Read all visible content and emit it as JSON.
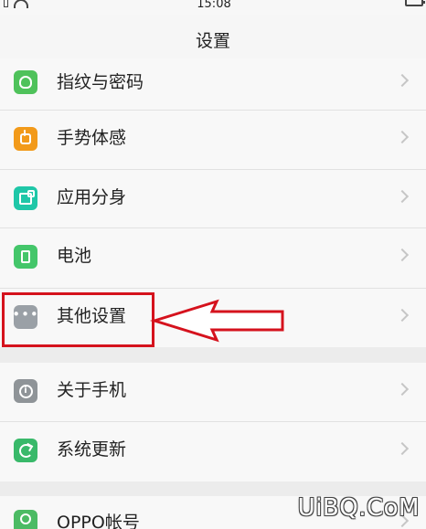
{
  "status_bar": {
    "time": "15:08"
  },
  "header": {
    "title": "设置"
  },
  "colors": {
    "fingerprint": "#4fc25b",
    "gesture": "#f29a1a",
    "app_clone": "#1fc7a8",
    "battery": "#44c66a",
    "other_settings": "#9aa0a6",
    "about_phone": "#8f9498",
    "system_update": "#39b96a",
    "account": "#4cbb64",
    "callout": "#d5121d"
  },
  "items": [
    {
      "label": "指纹与密码",
      "icon": "fingerprint-icon"
    },
    {
      "label": "手势体感",
      "icon": "gesture-icon"
    },
    {
      "label": "应用分身",
      "icon": "app-clone-icon"
    },
    {
      "label": "电池",
      "icon": "battery-icon"
    },
    {
      "label": "其他设置",
      "icon": "more-icon"
    },
    {
      "label": "关于手机",
      "icon": "info-icon"
    },
    {
      "label": "系统更新",
      "icon": "update-icon"
    },
    {
      "label": "OPPO帐号",
      "icon": "account-icon"
    }
  ],
  "watermark": {
    "text": "UiBQ.CoM"
  }
}
